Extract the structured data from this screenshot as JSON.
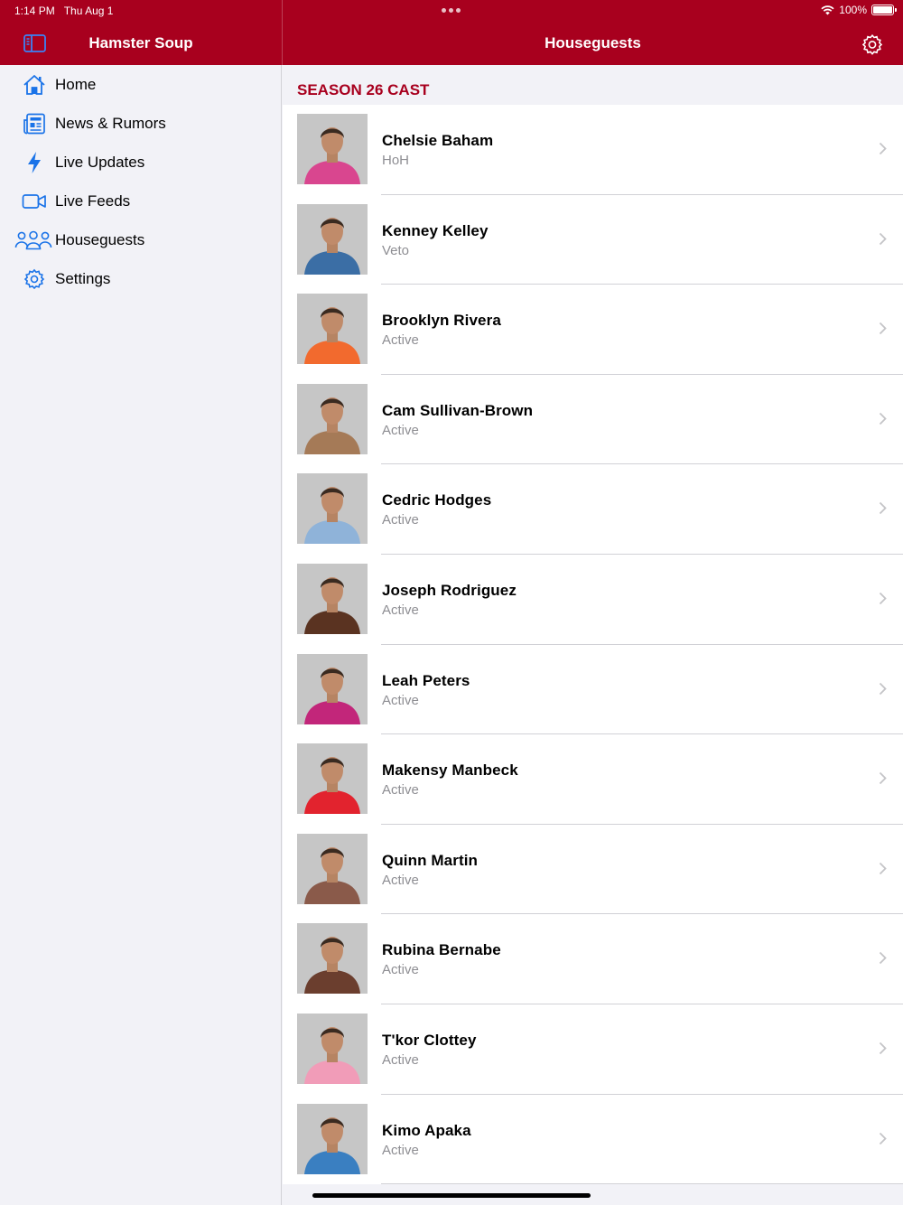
{
  "status_bar": {
    "time": "1:14 PM",
    "date": "Thu Aug 1",
    "battery": "100%",
    "battery_level": 1.0
  },
  "sidebar": {
    "title": "Hamster Soup",
    "items": [
      {
        "label": "Home",
        "icon": "house-icon"
      },
      {
        "label": "News & Rumors",
        "icon": "newspaper-icon"
      },
      {
        "label": "Live Updates",
        "icon": "bolt-icon"
      },
      {
        "label": "Live Feeds",
        "icon": "video-camera-icon"
      },
      {
        "label": "Houseguests",
        "icon": "people-icon"
      },
      {
        "label": "Settings",
        "icon": "gear-icon"
      }
    ]
  },
  "main": {
    "title": "Houseguests",
    "section": "SEASON 26 CAST",
    "houseguests": [
      {
        "name": "Chelsie Baham",
        "status": "HoH",
        "photo_color": "#d9468f"
      },
      {
        "name": "Kenney Kelley",
        "status": "Veto",
        "photo_color": "#3b6ea5"
      },
      {
        "name": "Brooklyn Rivera",
        "status": "Active",
        "photo_color": "#f26a2e"
      },
      {
        "name": "Cam Sullivan-Brown",
        "status": "Active",
        "photo_color": "#a57a57"
      },
      {
        "name": "Cedric Hodges",
        "status": "Active",
        "photo_color": "#8fb3d9"
      },
      {
        "name": "Joseph Rodriguez",
        "status": "Active",
        "photo_color": "#5a3321"
      },
      {
        "name": "Leah Peters",
        "status": "Active",
        "photo_color": "#c2267a"
      },
      {
        "name": "Makensy Manbeck",
        "status": "Active",
        "photo_color": "#e2232e"
      },
      {
        "name": "Quinn Martin",
        "status": "Active",
        "photo_color": "#8a5a4a"
      },
      {
        "name": "Rubina Bernabe",
        "status": "Active",
        "photo_color": "#6b3e2e"
      },
      {
        "name": "T'kor Clottey",
        "status": "Active",
        "photo_color": "#f19cb8"
      },
      {
        "name": "Kimo Apaka",
        "status": "Active",
        "photo_color": "#3a7fc1"
      }
    ]
  },
  "colors": {
    "brand": "#a8001e",
    "accent": "#1a73e8",
    "secondary_text": "#8e8e93"
  }
}
